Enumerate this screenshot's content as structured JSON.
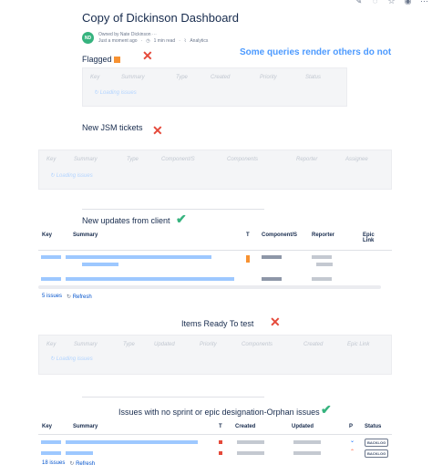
{
  "toolbar_icons": [
    "edit-icon",
    "comment-icon",
    "star-icon",
    "watch-icon",
    "more-icon"
  ],
  "page": {
    "title": "Copy of Dickinson Dashboard",
    "owner_line": "Owned by Nate Dickinson",
    "updated": "Just a moment ago",
    "read_time": "1 min read",
    "analytics": "Analytics",
    "avatar_initials": "ND",
    "note": "Some queries render others do not"
  },
  "sections": {
    "flagged": {
      "title": "Flagged",
      "columns": [
        "Key",
        "Summary",
        "Type",
        "Created",
        "Priority",
        "Status"
      ],
      "loading": "Loading issues"
    },
    "jsm": {
      "title": "New JSM tickets",
      "columns": [
        "Key",
        "Summary",
        "Type",
        "Component/S",
        "Components",
        "Reporter",
        "Assignee"
      ],
      "loading": "Loading issues"
    },
    "client": {
      "title": "New updates from client",
      "columns": [
        "Key",
        "Summary",
        "T",
        "Component/S",
        "Reporter",
        "Epic Link"
      ],
      "count": "5 issues",
      "refresh": "Refresh"
    },
    "ready": {
      "title": "Items Ready To test",
      "columns": [
        "Key",
        "Summary",
        "Type",
        "Updated",
        "Priority",
        "Components",
        "Created",
        "Epic Link"
      ],
      "loading": "Loading issues"
    },
    "orphan": {
      "title": "Issues with no sprint or epic designation-Orphan issues",
      "columns": [
        "Key",
        "Summary",
        "T",
        "Created",
        "Updated",
        "P",
        "Status"
      ],
      "count": "18 issues",
      "refresh": "Refresh",
      "status_1": "BACKLOG",
      "status_2": "BACKLOG"
    }
  },
  "colors": {
    "note": "#4c9aff",
    "error": "#e5493a",
    "ok": "#36b37e",
    "flag": "#f79232",
    "link": "#0052cc"
  }
}
